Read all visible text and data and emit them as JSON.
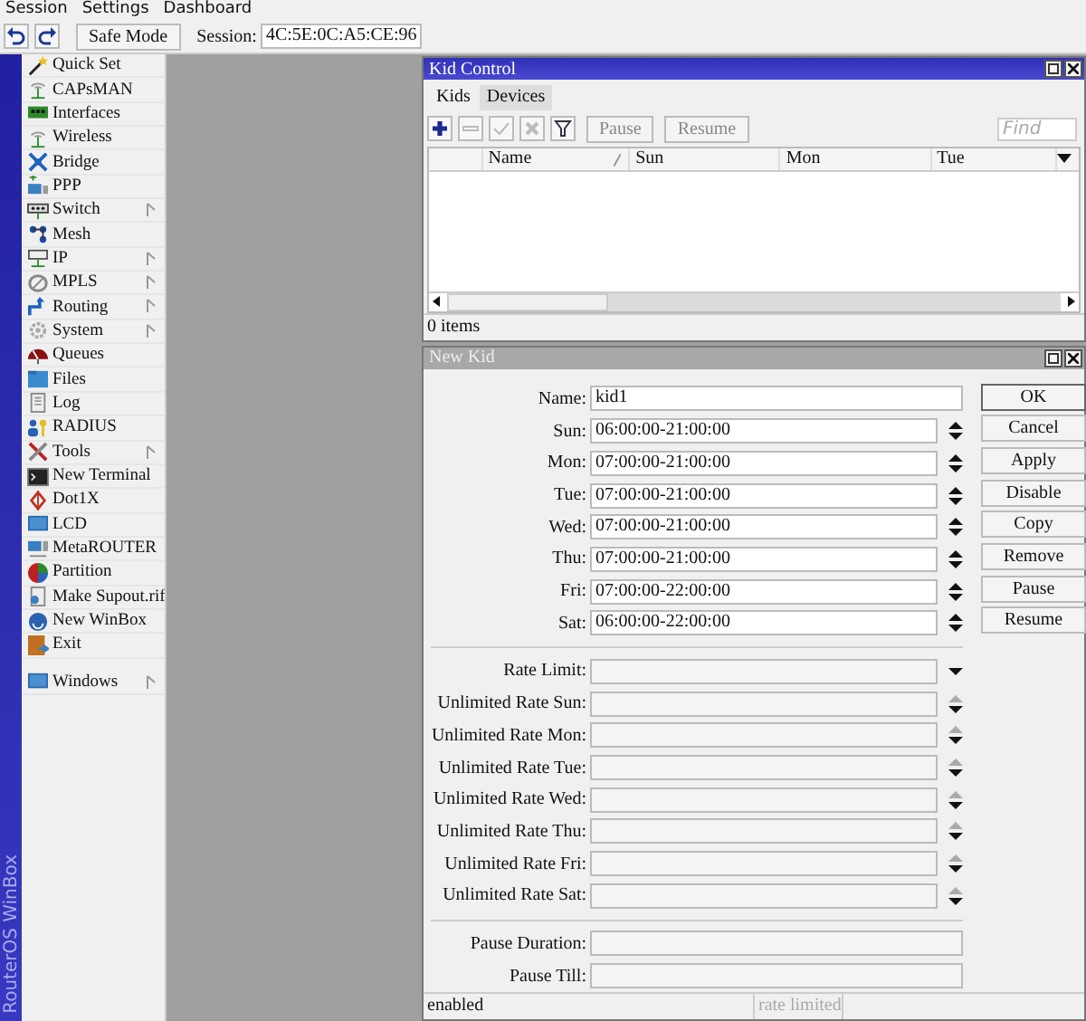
{
  "menubar": [
    "Session",
    "Settings",
    "Dashboard"
  ],
  "toolbar": {
    "safe_mode": "Safe Mode",
    "session_label": "Session:",
    "session_value": "4C:5E:0C:A5:CE:96"
  },
  "sidebar": {
    "brand": "RouterOS WinBox",
    "items": [
      {
        "label": "Quick Set",
        "submenu": false
      },
      {
        "label": "CAPsMAN",
        "submenu": false
      },
      {
        "label": "Interfaces",
        "submenu": false
      },
      {
        "label": "Wireless",
        "submenu": false
      },
      {
        "label": "Bridge",
        "submenu": false
      },
      {
        "label": "PPP",
        "submenu": false
      },
      {
        "label": "Switch",
        "submenu": true
      },
      {
        "label": "Mesh",
        "submenu": false
      },
      {
        "label": "IP",
        "submenu": true
      },
      {
        "label": "MPLS",
        "submenu": true
      },
      {
        "label": "Routing",
        "submenu": true
      },
      {
        "label": "System",
        "submenu": true
      },
      {
        "label": "Queues",
        "submenu": false
      },
      {
        "label": "Files",
        "submenu": false
      },
      {
        "label": "Log",
        "submenu": false
      },
      {
        "label": "RADIUS",
        "submenu": false
      },
      {
        "label": "Tools",
        "submenu": true
      },
      {
        "label": "New Terminal",
        "submenu": false
      },
      {
        "label": "Dot1X",
        "submenu": false
      },
      {
        "label": "LCD",
        "submenu": false
      },
      {
        "label": "MetaROUTER",
        "submenu": false
      },
      {
        "label": "Partition",
        "submenu": false
      },
      {
        "label": "Make Supout.rif",
        "submenu": false
      },
      {
        "label": "New WinBox",
        "submenu": false
      },
      {
        "label": "Exit",
        "submenu": false
      }
    ],
    "bottom_items": [
      {
        "label": "Windows",
        "submenu": true
      }
    ]
  },
  "kid_control": {
    "title": "Kid Control",
    "active": true,
    "tabs": [
      {
        "label": "Kids",
        "selected": true
      },
      {
        "label": "Devices",
        "selected": false
      }
    ],
    "icon_buttons": [
      {
        "kind": "add",
        "disabled": false
      },
      {
        "kind": "remove",
        "disabled": true
      },
      {
        "kind": "enable",
        "disabled": true
      },
      {
        "kind": "disable",
        "disabled": true
      },
      {
        "kind": "filter",
        "disabled": false
      }
    ],
    "text_buttons": [
      {
        "label": "Pause",
        "disabled": true
      },
      {
        "label": "Resume",
        "disabled": true
      }
    ],
    "find": {
      "placeholder": "Find"
    },
    "table": {
      "columns": [
        "Name",
        "Sun",
        "Mon",
        "Tue"
      ]
    },
    "status": "0 items"
  },
  "new_kid": {
    "title": "New Kid",
    "active": false,
    "sections": [
      [
        {
          "label": "Name:",
          "value": "kid1",
          "kind": "text"
        },
        {
          "label": "Sun:",
          "value": "06:00:00-21:00:00",
          "kind": "time"
        },
        {
          "label": "Mon:",
          "value": "07:00:00-21:00:00",
          "kind": "time"
        },
        {
          "label": "Tue:",
          "value": "07:00:00-21:00:00",
          "kind": "time"
        },
        {
          "label": "Wed:",
          "value": "07:00:00-21:00:00",
          "kind": "time"
        },
        {
          "label": "Thu:",
          "value": "07:00:00-21:00:00",
          "kind": "time"
        },
        {
          "label": "Fri:",
          "value": "07:00:00-22:00:00",
          "kind": "time"
        },
        {
          "label": "Sat:",
          "value": "06:00:00-22:00:00",
          "kind": "time"
        }
      ],
      [
        {
          "label": "Rate Limit:",
          "kind": "select"
        },
        {
          "label": "Unlimited Rate Sun:",
          "kind": "rate"
        },
        {
          "label": "Unlimited Rate Mon:",
          "kind": "rate"
        },
        {
          "label": "Unlimited Rate Tue:",
          "kind": "rate"
        },
        {
          "label": "Unlimited Rate Wed:",
          "kind": "rate"
        },
        {
          "label": "Unlimited Rate Thu:",
          "kind": "rate"
        },
        {
          "label": "Unlimited Rate Fri:",
          "kind": "rate"
        },
        {
          "label": "Unlimited Rate Sat:",
          "kind": "rate"
        }
      ],
      [
        {
          "label": "Pause Duration:",
          "kind": "text"
        },
        {
          "label": "Pause Till:",
          "kind": "text"
        }
      ]
    ],
    "buttons": [
      {
        "label": "OK",
        "default": true
      },
      {
        "label": "Cancel",
        "default": false
      },
      {
        "label": "Apply",
        "default": false
      },
      {
        "label": "Disable",
        "default": false
      },
      {
        "label": "Copy",
        "default": false
      },
      {
        "label": "Remove",
        "default": false
      },
      {
        "label": "Pause",
        "default": false
      },
      {
        "label": "Resume",
        "default": false
      }
    ],
    "status": [
      {
        "text": "enabled",
        "disabled": false
      },
      {
        "text": "rate limited",
        "disabled": true
      }
    ]
  }
}
